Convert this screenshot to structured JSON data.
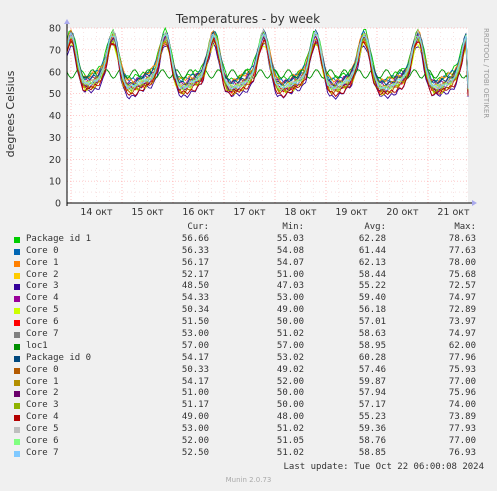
{
  "chart_data": {
    "type": "line",
    "title": "Temperatures - by week",
    "ylabel": "degrees Celsius",
    "ylim": [
      0,
      80
    ],
    "yticks": [
      0,
      10,
      20,
      30,
      40,
      50,
      60,
      70,
      80
    ],
    "x_ticks": [
      "14 окт",
      "15 окт",
      "16 окт",
      "17 окт",
      "18 окт",
      "19 окт",
      "20 окт",
      "21 окт"
    ],
    "grid": true,
    "side_label": "RRDTOOL / TOBI OETIKER",
    "legend_headers": [
      "Cur:",
      "Min:",
      "Avg:",
      "Max:"
    ],
    "series": [
      {
        "name": "Package id 1",
        "color": "#00cc00",
        "cur": "56.66",
        "min": "55.03",
        "avg": "62.28",
        "max": "78.63"
      },
      {
        "name": "Core 0",
        "color": "#0066b3",
        "cur": "56.33",
        "min": "54.08",
        "avg": "61.44",
        "max": "77.63"
      },
      {
        "name": "Core 1",
        "color": "#ff8000",
        "cur": "56.17",
        "min": "54.07",
        "avg": "62.13",
        "max": "78.00"
      },
      {
        "name": "Core 2",
        "color": "#ffcc00",
        "cur": "52.17",
        "min": "51.00",
        "avg": "58.44",
        "max": "75.68"
      },
      {
        "name": "Core 3",
        "color": "#330099",
        "cur": "48.50",
        "min": "47.03",
        "avg": "55.22",
        "max": "72.57"
      },
      {
        "name": "Core 4",
        "color": "#990099",
        "cur": "54.33",
        "min": "53.00",
        "avg": "59.40",
        "max": "74.97"
      },
      {
        "name": "Core 5",
        "color": "#ccff00",
        "cur": "50.34",
        "min": "49.00",
        "avg": "56.18",
        "max": "72.89"
      },
      {
        "name": "Core 6",
        "color": "#ff0000",
        "cur": "51.50",
        "min": "50.00",
        "avg": "57.01",
        "max": "73.97"
      },
      {
        "name": "Core 7",
        "color": "#808080",
        "cur": "53.00",
        "min": "51.02",
        "avg": "58.63",
        "max": "74.97"
      },
      {
        "name": "loc1",
        "color": "#008f00",
        "cur": "57.00",
        "min": "57.00",
        "avg": "58.95",
        "max": "62.00"
      },
      {
        "name": "Package id 0",
        "color": "#00487d",
        "cur": "54.17",
        "min": "53.02",
        "avg": "60.28",
        "max": "77.96"
      },
      {
        "name": "Core 0",
        "color": "#b35a00",
        "cur": "50.33",
        "min": "49.02",
        "avg": "57.46",
        "max": "75.93"
      },
      {
        "name": "Core 1",
        "color": "#b38f00",
        "cur": "54.17",
        "min": "52.00",
        "avg": "59.87",
        "max": "77.00"
      },
      {
        "name": "Core 2",
        "color": "#6b006b",
        "cur": "51.00",
        "min": "50.00",
        "avg": "57.94",
        "max": "75.96"
      },
      {
        "name": "Core 3",
        "color": "#8fb300",
        "cur": "51.17",
        "min": "50.00",
        "avg": "57.17",
        "max": "74.00"
      },
      {
        "name": "Core 4",
        "color": "#b30000",
        "cur": "49.00",
        "min": "48.00",
        "avg": "55.23",
        "max": "73.89"
      },
      {
        "name": "Core 5",
        "color": "#bebebe",
        "cur": "53.00",
        "min": "51.02",
        "avg": "59.36",
        "max": "77.93"
      },
      {
        "name": "Core 6",
        "color": "#80ff80",
        "cur": "52.00",
        "min": "51.05",
        "avg": "58.76",
        "max": "77.00"
      },
      {
        "name": "Core 7",
        "color": "#80c9ff",
        "cur": "52.50",
        "min": "51.02",
        "avg": "58.85",
        "max": "76.93"
      }
    ]
  },
  "footer": {
    "last_update": "Last update: Tue Oct 22 06:00:08 2024",
    "munin": "Munin 2.0.73"
  }
}
